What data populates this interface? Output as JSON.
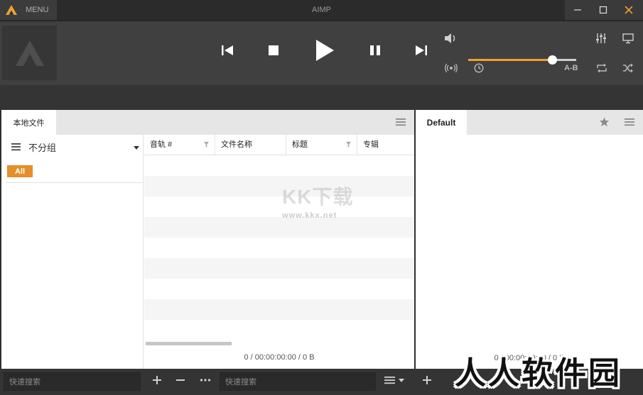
{
  "window": {
    "title": "AIMP",
    "menu_label": "MENU"
  },
  "player": {
    "volume_level": 0.78,
    "ab_label": "A-B"
  },
  "left_panel": {
    "tab_label": "本地文件",
    "group_label": "不分组",
    "filter_badge": "All",
    "columns": [
      "音轨 #",
      "文件名称",
      "标题",
      "专辑"
    ],
    "status": "0 / 00:00:00:00 / 0 B"
  },
  "right_panel": {
    "tab_label": "Default",
    "status": "0 / 00:00:00:00 / 0 B"
  },
  "bottom": {
    "search_placeholder_left": "快速搜索",
    "search_placeholder_right": "快速搜索"
  },
  "watermarks": {
    "center_title": "KK下载",
    "center_url": "www.kkx.net",
    "corner": "人人软件园"
  },
  "colors": {
    "accent": "#f0a030",
    "badge": "#e58f2a"
  }
}
